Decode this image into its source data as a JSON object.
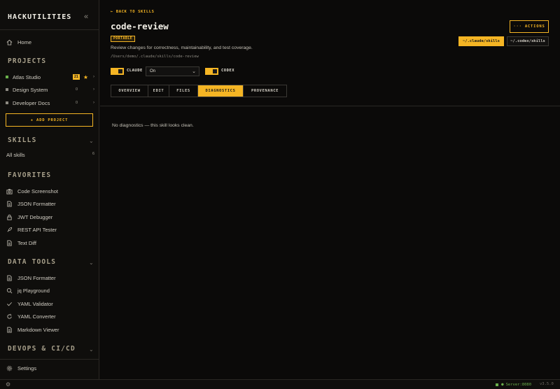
{
  "sidebar": {
    "brand": "HACKUTILITIES",
    "home": "Home",
    "sections": {
      "projects": "PROJECTS",
      "skills": "SKILLS",
      "favorites": "FAVORITES",
      "data_tools": "DATA TOOLS",
      "devops": "DEVOPS & CI/CD"
    },
    "projects": [
      {
        "name": "Atlas Studio",
        "count": "21",
        "dot_color": "#6ab04c"
      },
      {
        "name": "Design System",
        "count": "0",
        "dot_color": "#8d8a82"
      },
      {
        "name": "Developer Docs",
        "count": "0",
        "dot_color": "#8d8a82"
      }
    ],
    "add_project": "+ ADD PROJECT",
    "all_skills": {
      "label": "All skills",
      "count": "6"
    },
    "favorites": [
      {
        "label": "Code Screenshot",
        "icon": "camera-icon"
      },
      {
        "label": "JSON Formatter",
        "icon": "file-icon"
      },
      {
        "label": "JWT Debugger",
        "icon": "lock-icon"
      },
      {
        "label": "REST API Tester",
        "icon": "rocket-icon"
      },
      {
        "label": "Text Diff",
        "icon": "file-icon"
      }
    ],
    "data_tools": [
      {
        "label": "JSON Formatter",
        "icon": "file-icon"
      },
      {
        "label": "jq Playground",
        "icon": "search-icon"
      },
      {
        "label": "YAML Validator",
        "icon": "check-icon"
      },
      {
        "label": "YAML Converter",
        "icon": "refresh-icon"
      },
      {
        "label": "Markdown Viewer",
        "icon": "file-icon"
      }
    ],
    "settings": "Settings"
  },
  "main": {
    "back": "← BACK TO SKILLS",
    "title": "code-review",
    "tag": "PORTABLE",
    "description": "Review changes for correctness, maintainability, and test coverage.",
    "path": "/Users/demo/.claude/skills/code-review",
    "actions": "··· ACTIONS",
    "path_buttons": [
      "~/.claude/skills",
      "~/.codex/skills"
    ],
    "claude_label": "CLAUDE",
    "claude_select": "On",
    "codex_label": "CODEX",
    "tabs": [
      "OVERVIEW",
      "EDIT",
      "FILES",
      "DIAGNOSTICS",
      "PROVENANCE"
    ],
    "active_tab": "DIAGNOSTICS",
    "empty_message": "No diagnostics — this skill looks clean."
  },
  "status": {
    "server": "Server:8080",
    "version": "v3.5.0"
  },
  "colors": {
    "accent": "#f5b524",
    "ok": "#6ab04c",
    "background": "#0b0a09"
  }
}
